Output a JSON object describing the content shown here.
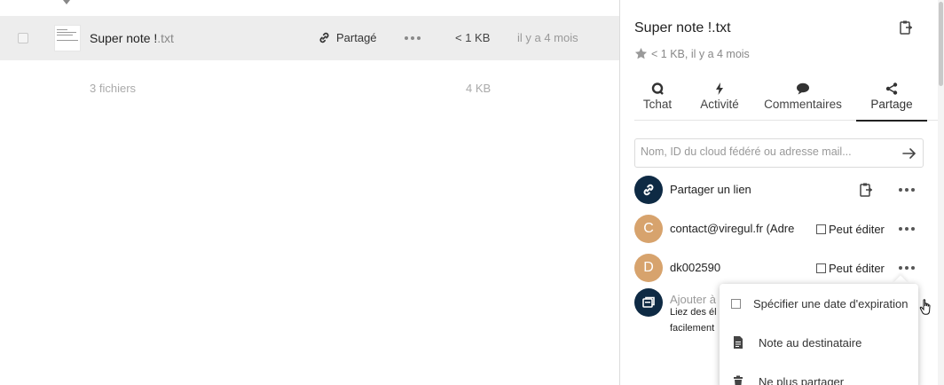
{
  "file_list": {
    "row": {
      "name": "Super note !",
      "extension": ".txt",
      "share_label": "Partagé",
      "size": "< 1 KB",
      "modified": "il y a 4 mois"
    },
    "summary": {
      "count": "3 fichiers",
      "total_size": "4 KB"
    }
  },
  "sidebar": {
    "title": "Super note !.txt",
    "meta": "< 1 KB, il y a 4 mois",
    "tabs": [
      {
        "label": "Tchat",
        "icon": "chat-icon"
      },
      {
        "label": "Activité",
        "icon": "bolt-icon"
      },
      {
        "label": "Commentaires",
        "icon": "comment-icon"
      },
      {
        "label": "Partage",
        "icon": "share-icon"
      }
    ],
    "active_tab": "Partage",
    "share_input_placeholder": "Nom, ID du cloud fédéré ou adresse mail...",
    "link_share_label": "Partager un lien",
    "sharees": [
      {
        "initial": "C",
        "name": "contact@viregul.fr (Adre",
        "permission": "Peut éditer"
      },
      {
        "initial": "D",
        "name": "dk002590",
        "permission": "Peut éditer"
      }
    ],
    "add_note": "Ajouter à",
    "add_desc_line1": "Liez des él",
    "add_desc_line2": "facilement"
  },
  "popover": {
    "items": [
      {
        "label": "Spécifier une date d'expiration",
        "icon": "checkbox"
      },
      {
        "label": "Note au destinataire",
        "icon": "note-icon"
      },
      {
        "label": "Ne plus partager",
        "icon": "trash-icon"
      }
    ]
  },
  "colors": {
    "avatar_dark": "#0e2a44",
    "avatar_tan": "#d7a36d",
    "selected_row": "#ededed"
  }
}
